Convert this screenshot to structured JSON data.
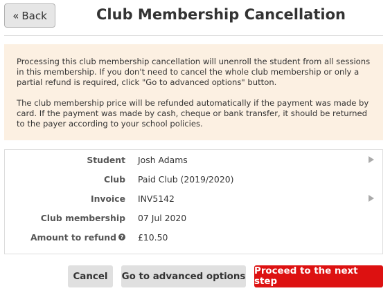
{
  "header": {
    "back_label": "Back",
    "title": "Club Membership Cancellation"
  },
  "notice": {
    "paragraph1": "Processing this club membership cancellation will unenroll the student from all sessions in this membership. If you don't need to cancel the whole club membership or only a partial refund is required, click \"Go to advanced options\" button.",
    "paragraph2": "The club membership price will be refunded automatically if the payment was made by card. If the payment was made by cash, cheque or bank transfer, it should be returned to the payer according to your school policies."
  },
  "details": {
    "rows": [
      {
        "label": "Student",
        "value": "Josh Adams"
      },
      {
        "label": "Club",
        "value": "Paid Club (2019/2020)"
      },
      {
        "label": "Invoice",
        "value": "INV5142"
      },
      {
        "label": "Club membership",
        "value": "07 Jul 2020"
      },
      {
        "label": "Amount to refund",
        "value": "£10.50"
      }
    ]
  },
  "actions": {
    "cancel_label": "Cancel",
    "advanced_label": "Go to advanced options",
    "proceed_label": "Proceed to the next step"
  },
  "colors": {
    "notice_bg": "#fcf0e2",
    "primary": "#dd1111",
    "secondary_btn": "#e0e0e0"
  }
}
